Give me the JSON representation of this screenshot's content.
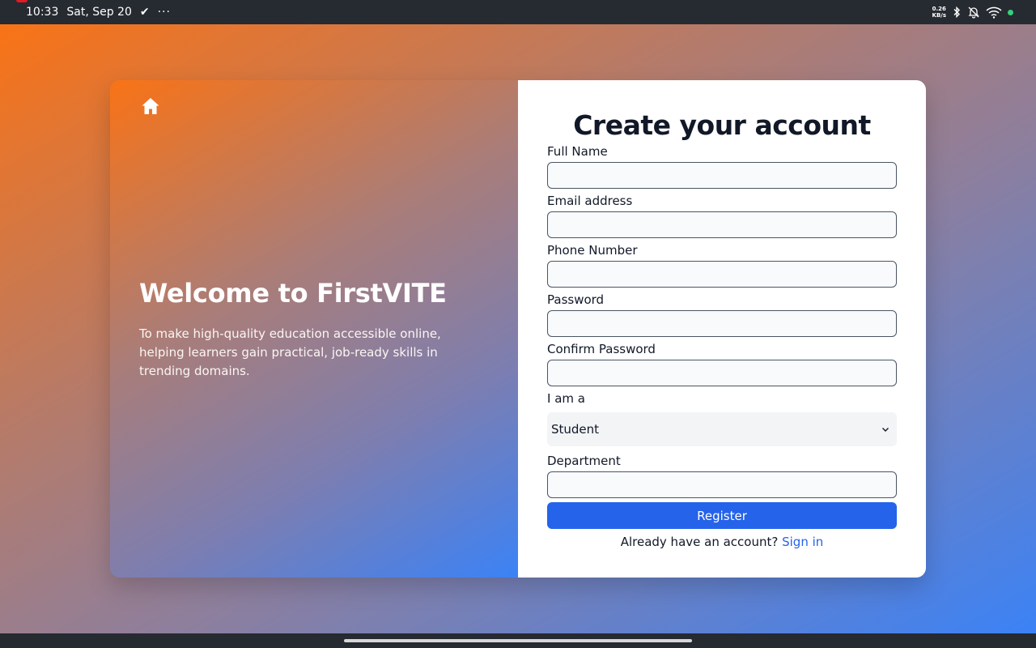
{
  "status_bar": {
    "time": "10:33",
    "date": "Sat, Sep 20",
    "check": "✔",
    "more": "···",
    "net_speed_value": "0.26",
    "net_speed_unit": "KB/s"
  },
  "left_panel": {
    "title": "Welcome to FirstVITE",
    "description": "To make high-quality education accessible online, helping learners gain practical, job-ready skills in trending domains."
  },
  "form": {
    "title": "Create your account",
    "fields": [
      {
        "label": "Full Name",
        "value": ""
      },
      {
        "label": "Email address",
        "value": ""
      },
      {
        "label": "Phone Number",
        "value": ""
      },
      {
        "label": "Password",
        "value": ""
      },
      {
        "label": "Confirm Password",
        "value": ""
      }
    ],
    "role": {
      "label": "I am a",
      "selected": "Student"
    },
    "department": {
      "label": "Department",
      "value": ""
    },
    "register_label": "Register",
    "signin_prompt": "Already have an account?",
    "signin_link": "Sign in"
  },
  "colors": {
    "accent": "#2563eb",
    "gradient_start": "#f97316",
    "gradient_end": "#3b82f6"
  },
  "icons": [
    "home-icon",
    "chevron-down-icon",
    "bluetooth-icon",
    "bell-off-icon",
    "wifi-icon"
  ]
}
